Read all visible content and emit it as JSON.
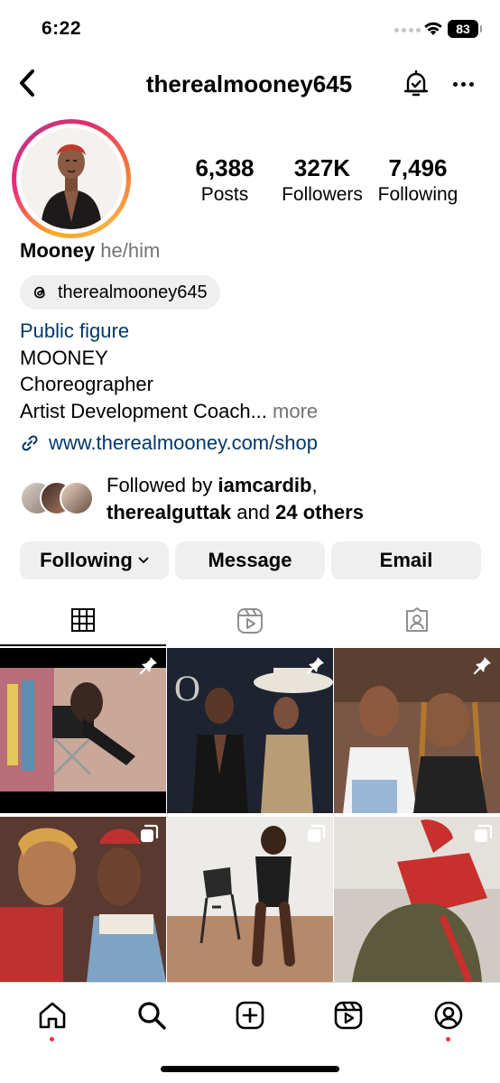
{
  "status_bar": {
    "time": "6:22",
    "battery": "83"
  },
  "header": {
    "username": "therealmooney645"
  },
  "profile": {
    "stats": [
      {
        "value": "6,388",
        "label": "Posts"
      },
      {
        "value": "327K",
        "label": "Followers"
      },
      {
        "value": "7,496",
        "label": "Following"
      }
    ],
    "name": "Mooney",
    "pronouns": "he/him",
    "threads_handle": "therealmooney645",
    "category": "Public figure",
    "bio_lines": [
      "MOONEY",
      "Choreographer",
      "Artist Development Coach"
    ],
    "bio_ellipsis": "...",
    "more_label": "more",
    "link": "www.therealmooney.com/shop",
    "followed_by": {
      "prefix": "Followed by",
      "user1": "iamcardib",
      "comma": ",",
      "user2": "therealguttak",
      "and": "and",
      "others": "24 others"
    }
  },
  "buttons": {
    "following": "Following",
    "message": "Message",
    "email": "Email"
  },
  "tabs": [
    {
      "icon": "grid-icon",
      "selected": true
    },
    {
      "icon": "reels-icon",
      "selected": false
    },
    {
      "icon": "tagged-icon",
      "selected": false
    }
  ],
  "grid_posts": [
    {
      "badge": "pin-icon"
    },
    {
      "badge": "pin-icon"
    },
    {
      "badge": "pin-icon"
    },
    {
      "badge": "carousel-icon"
    },
    {
      "badge": "carousel-icon"
    },
    {
      "badge": "carousel-icon"
    }
  ],
  "bottom_nav": [
    "home-icon",
    "search-icon",
    "create-icon",
    "reels-icon",
    "profile-icon"
  ],
  "colors": {
    "link": "#00376b",
    "secondary_text": "#737373",
    "button_bg": "#efefef",
    "notification_dot": "#ff3040"
  }
}
